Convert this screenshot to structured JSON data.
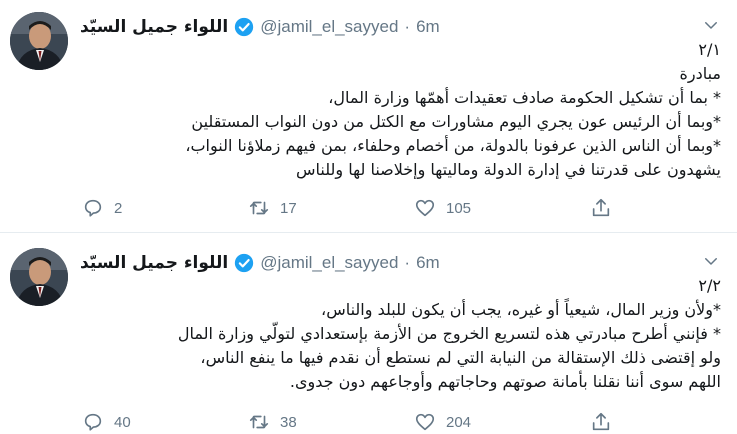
{
  "tweets": [
    {
      "author_name": "اللواء جميل السيّد",
      "handle": "@jamil_el_sayyed",
      "separator": "·",
      "time": "6m",
      "lines": [
        "٢/١",
        "مبادرة",
        "* بما أن تشكيل الحكومة صادف تعقيدات أهمّها وزارة المال،",
        "*وبما أن الرئيس عون يجري اليوم مشاورات مع الكتل من دون النواب المستقلين",
        "*وبما أن الناس الذين عرفونا بالدولة، من أخصام وحلفاء، بمن فيهم زملاؤنا النواب،",
        "يشهدون على قدرتنا في إدارة الدولة وماليتها وإخلاصنا لها وللناس"
      ],
      "replies": "2",
      "retweets": "17",
      "likes": "105"
    },
    {
      "author_name": "اللواء جميل السيّد",
      "handle": "@jamil_el_sayyed",
      "separator": "·",
      "time": "6m",
      "lines": [
        "٢/٢",
        "*ولأن وزير المال، شيعياً أو غيره، يجب أن يكون للبلد والناس،",
        "* فإنني أطرح مبادرتي هذه لتسريع الخروج من الأزمة بإستعدادي لتولّي وزارة المال",
        "ولو إقتضى ذلك الإستقالة من النيابة التي لم نستطع أن نقدم فيها ما ينفع الناس،",
        "اللهم سوى أننا نقلنا بأمانة صوتهم وحاجاتهم وأوجاعهم دون جدوى."
      ],
      "replies": "40",
      "retweets": "38",
      "likes": "204"
    }
  ],
  "colors": {
    "verified": "#1da1f2",
    "muted": "#657786",
    "text": "#14171a"
  },
  "icons": {
    "reply": "reply-icon",
    "retweet": "retweet-icon",
    "like": "heart-icon",
    "share": "share-icon",
    "menu": "chevron-down-icon",
    "verified": "verified-badge-icon"
  }
}
